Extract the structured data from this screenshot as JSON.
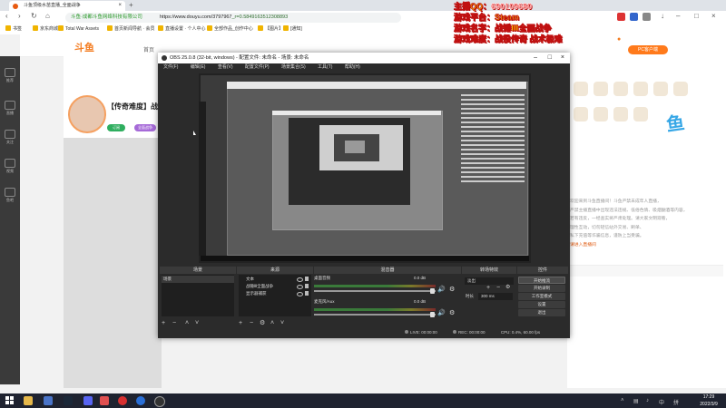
{
  "browser": {
    "tab_title": "斗鱼顶级水苗直播_全面战争",
    "url_site": "斗鱼·成都斗鱼网络科技有限公司",
    "url_host": "https://www.douyu.com/3797967",
    "url_rest": "_r=0.5849163512308893",
    "bookmarks": [
      "书签",
      "京东商城",
      "Total War Assets",
      "首页新闻导航 · 会员",
      "直播设置 · 个人中心",
      "全部作品_创作中心",
      "【图片】",
      "[通知]"
    ]
  },
  "site": {
    "logo": "斗鱼",
    "nav": [
      "首页",
      "直播",
      "分类",
      "游戏",
      "鱼吧"
    ],
    "fish_bar": "PC客户端",
    "room_title": "【传奇难度】战锤",
    "tag1": "订阅",
    "tag2": "全面战争",
    "side_nav": [
      "推荐",
      "直播",
      "关注",
      "视频",
      "鱼吧"
    ],
    "chat_lines": [
      "欢迎来到斗鱼直播间！斗鱼严禁未成年人直播，",
      "严禁主播直播中出现违法违规、低俗色情、吸烟酗酒等内容，",
      "若有违反，一经查实将严肃处理。请大家文明观看，",
      "理性互动，切勿轻信站外交易、刷单、",
      "私下充值等诈骗信息，谨防上当受骗。"
    ],
    "chat_highlight": "请进入直播间"
  },
  "overlay": {
    "line1_label": "主播QQ：",
    "line1_value": "690109680",
    "line2": "游戏平台：Steam",
    "line3": "游戏名字：战锤Ⅲ全面战争",
    "line4": "游戏难度：战役传奇 战术极难"
  },
  "obs": {
    "title": "OBS 25.0.8 (32-bit, windows) - 配置文件: 未命名 - 场景: 未命名",
    "menu": [
      "文件(F)",
      "编辑(E)",
      "查看(V)",
      "配置文件(P)",
      "场景集合(S)",
      "工具(T)",
      "帮助(H)"
    ],
    "docks": {
      "scenes": "场景",
      "sources": "来源",
      "mixer": "混音器",
      "transitions": "转场特效",
      "controls": "控件"
    },
    "scene_items": [
      "场景"
    ],
    "sources": [
      "文本",
      "战锤Ⅲ全面战争",
      "显示器捕获"
    ],
    "mixer": [
      {
        "name": "桌面音频",
        "db": "0.0 dB"
      },
      {
        "name": "麦克风/Aux",
        "db": "0.0 dB"
      }
    ],
    "transition": {
      "type": "淡出",
      "duration_label": "时长",
      "duration_value": "300 ms"
    },
    "controls": [
      "开始推流",
      "开始录制",
      "工作室模式",
      "设置",
      "退出"
    ],
    "status": {
      "live": "LIVE: 00:00:00",
      "rec": "REC: 00:00:00",
      "cpu": "CPU: 0.4%, 60.00 fps"
    }
  },
  "taskbar": {
    "time": "17:29",
    "date": "2022/3/9"
  }
}
